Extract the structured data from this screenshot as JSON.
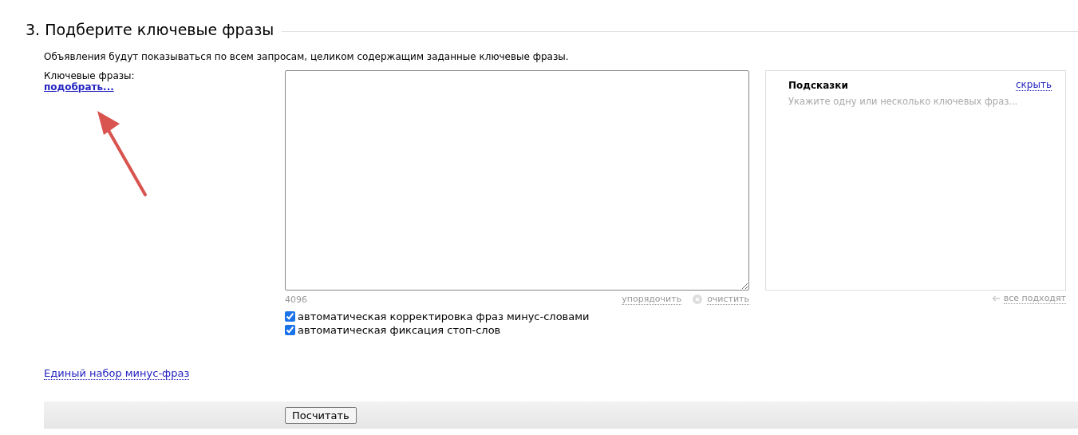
{
  "section_title": "3. Подберите ключевые фразы",
  "description": "Объявления будут показываться по всем запросам, целиком содержащим заданные ключевые фразы.",
  "keywords": {
    "label": "Ключевые фразы:",
    "pick_link": "подобрать...",
    "counter": "4096",
    "sort_link": "упорядочить",
    "clear_link": "очистить"
  },
  "options": [
    {
      "label": "автоматическая корректировка фраз минус-словами",
      "checked": true
    },
    {
      "label": "автоматическая фиксация стоп-слов",
      "checked": true
    }
  ],
  "hints": {
    "title": "Подсказки",
    "hide_link": "скрыть",
    "message": "Укажите одну или несколько ключевых фраз...",
    "all_fit_link": "все подходят"
  },
  "minus_phrases_link": "Единый набор минус-фраз",
  "calculate_button": "Посчитать"
}
